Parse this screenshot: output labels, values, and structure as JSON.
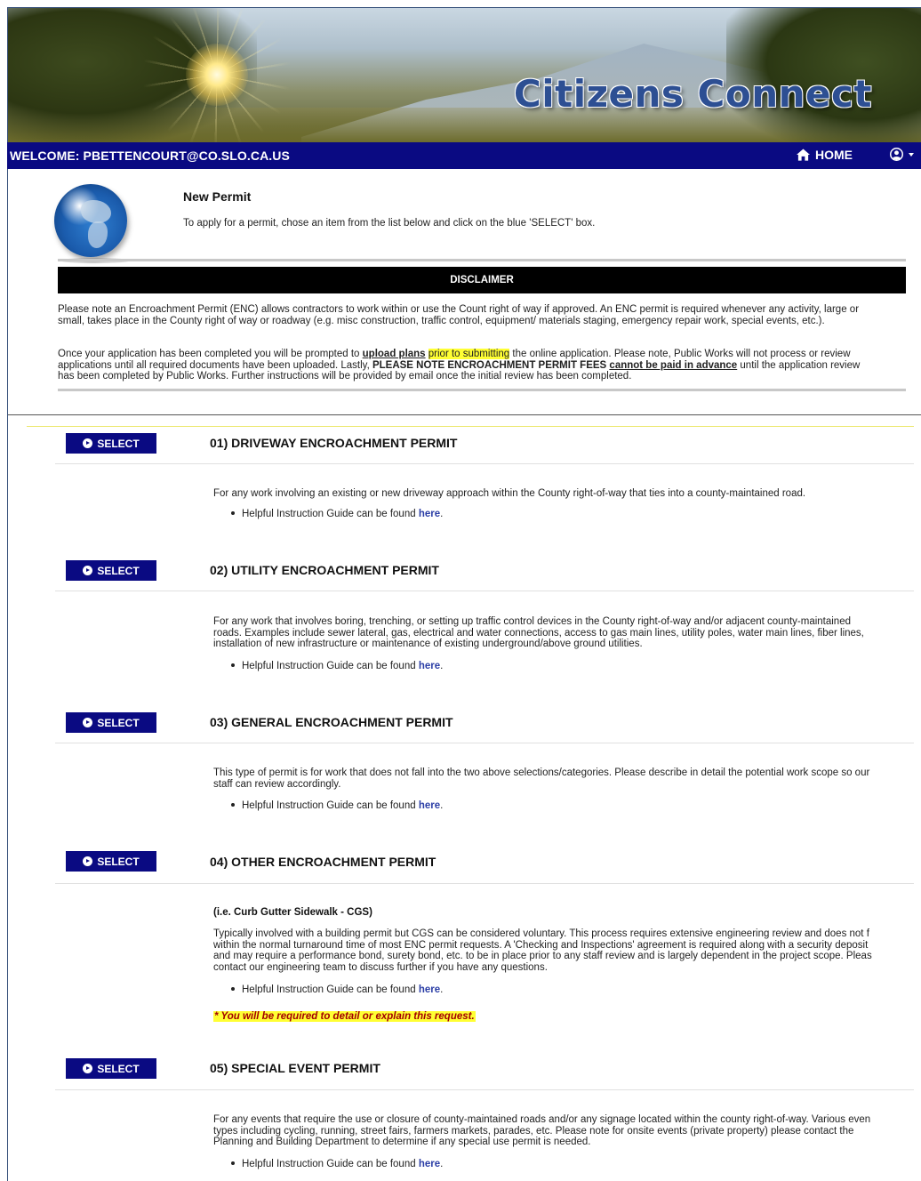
{
  "banner": {
    "brand_text": "Citizens Connect"
  },
  "navbar": {
    "welcome": "WELCOME: PBETTENCOURT@CO.SLO.CA.US",
    "home_label": "HOME",
    "home_icon": "home-icon",
    "user_icon": "user-circle-icon"
  },
  "intro": {
    "title": "New Permit",
    "subtitle": "To apply for a permit, chose an item from the list below and click on the blue 'SELECT' box.",
    "disclaimer_label": "DISCLAIMER",
    "p1_line1": "Please note an Encroachment Permit (ENC) allows contractors to work within or use the Count right of way if approved. An ENC permit is required whenever any activity, large or",
    "p1_line2": "small, takes place in the County right of way or roadway (e.g. misc construction, traffic control, equipment/ materials staging, emergency repair work, special events, etc.).",
    "p2_a": "Once your application has been completed you will be prompted to ",
    "p2_b": "upload plans",
    "p2_c": " ",
    "p2_d": "prior to submitting",
    "p2_e": " the online application. Please note, Public Works will not process or review",
    "p2_line2a": "applications until all required documents have been uploaded. Lastly, ",
    "p2_line2b": "PLEASE NOTE ENCROACHMENT PERMIT FEES",
    "p2_line2c": " ",
    "p2_line2d": "cannot be paid in advance",
    "p2_line2e": " until the application review",
    "p2_line3": "has been completed by Public Works. Further instructions will be provided by email once the initial review has been completed."
  },
  "select_label": "SELECT",
  "guide_text": "Helpful Instruction Guide can be found ",
  "guide_link": "here",
  "guide_period": ".",
  "permits": [
    {
      "title": "01) DRIVEWAY ENCROACHMENT PERMIT",
      "lines": [
        "For any work involving an existing or new driveway approach within the County right-of-way that ties into a county-maintained road."
      ]
    },
    {
      "title": "02) UTILITY ENCROACHMENT PERMIT",
      "lines": [
        "For any work that involves boring, trenching, or setting up traffic control devices in the County right-of-way and/or adjacent county-maintained",
        "roads. Examples include sewer lateral, gas, electrical and water connections, access to gas main lines, utility poles, water main lines, fiber lines,",
        "installation of new infrastructure or maintenance of existing underground/above ground utilities."
      ]
    },
    {
      "title": "03) GENERAL ENCROACHMENT PERMIT",
      "lines": [
        "This type of permit is for work that does not fall into the two above selections/categories. Please describe in detail the potential work scope so our",
        "staff can review accordingly."
      ]
    },
    {
      "title": "04) OTHER ENCROACHMENT PERMIT",
      "subhead": "(i.e. Curb Gutter Sidewalk - CGS)",
      "lines": [
        "Typically involved with a building permit but CGS can be considered voluntary. This process requires extensive engineering review and does not f",
        "within the normal turnaround time of most ENC permit requests. A 'Checking and Inspections' agreement is required along with a security deposit",
        "and may require a performance bond, surety bond, etc. to be in place prior to any staff review and is largely dependent in the project scope. Pleas",
        "contact our engineering team to discuss further if you have any questions."
      ],
      "required_note": "* You will be required to detail or explain this request."
    },
    {
      "title": "05) SPECIAL EVENT PERMIT",
      "lines": [
        "For any events that require the use or closure of county-maintained roads and/or any signage located within the county right-of-way. Various even",
        "types including cycling, running, street fairs, farmers markets, parades, etc. Please note for onsite events (private property) please contact the",
        "Planning and Building Department to determine if any special use permit is needed."
      ]
    }
  ],
  "colors": {
    "navy": "#0a0a82",
    "highlight": "#ffff33",
    "link": "#2b3ea6"
  }
}
